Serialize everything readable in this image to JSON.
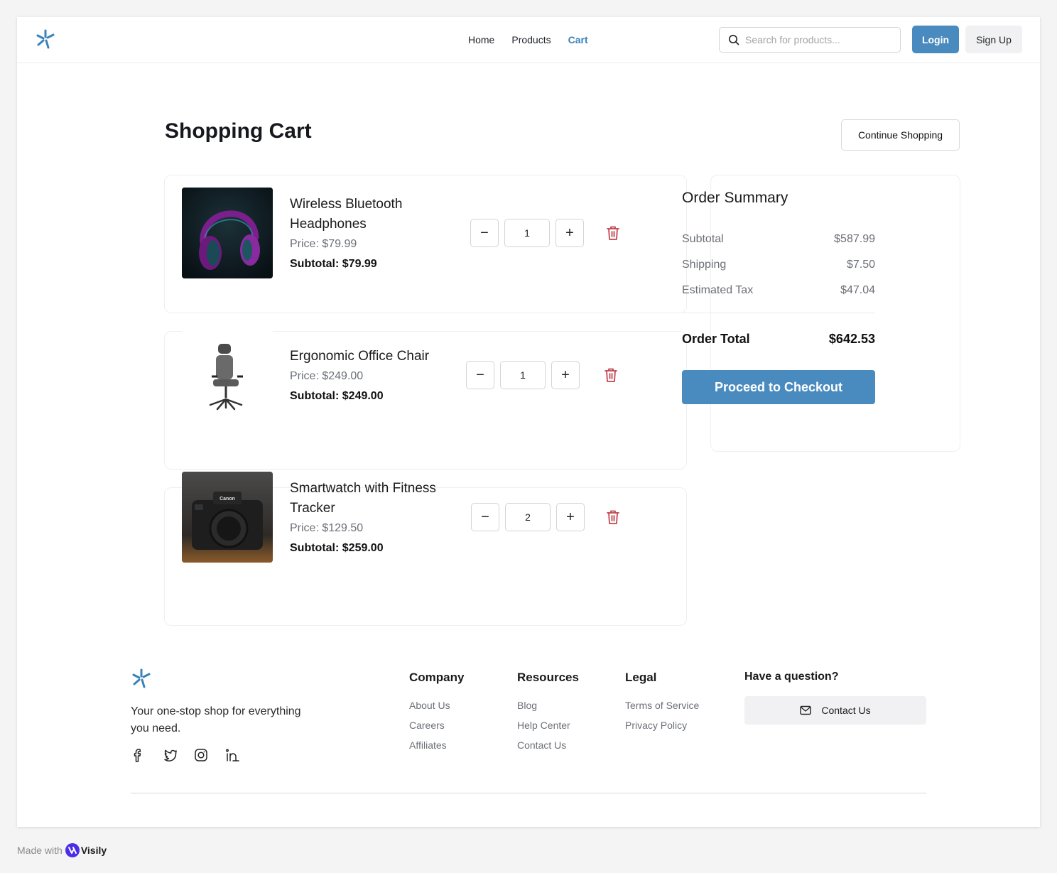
{
  "colors": {
    "accent": "#4a8bbf",
    "danger": "#c0444f",
    "text": "#1a1a1a",
    "muted": "#6b6f76"
  },
  "header": {
    "nav": [
      {
        "label": "Home",
        "active": false
      },
      {
        "label": "Products",
        "active": false
      },
      {
        "label": "Cart",
        "active": true
      }
    ],
    "search": {
      "placeholder": "Search for products...",
      "value": "",
      "icon": "search-icon"
    },
    "login_label": "Login",
    "signup_label": "Sign Up"
  },
  "page": {
    "title": "Shopping Cart",
    "continue_label": "Continue Shopping"
  },
  "cart": {
    "items": [
      {
        "name_line1": "Wireless Bluetooth",
        "name_line2": "Headphones",
        "price": "Price: $79.99",
        "subtotal": "Subtotal: $79.99",
        "quantity": "1",
        "image": "headphones-photo"
      },
      {
        "name_line1": "Ergonomic Office Chair",
        "name_line2": "",
        "price": "Price: $249.00",
        "subtotal": "Subtotal: $249.00",
        "quantity": "1",
        "image": "office-chair-photo"
      },
      {
        "name_line1": "Smartwatch with Fitness",
        "name_line2": "Tracker",
        "price": "Price: $129.50",
        "subtotal": "Subtotal: $259.00",
        "quantity": "2",
        "image": "camera-photo"
      }
    ],
    "decrement_glyph": "−",
    "increment_glyph": "+"
  },
  "summary": {
    "title": "Order Summary",
    "rows": [
      {
        "label": "Subtotal",
        "value": "$587.99"
      },
      {
        "label": "Shipping",
        "value": "$7.50"
      },
      {
        "label": "Estimated Tax",
        "value": "$47.04"
      }
    ],
    "total_label": "Order Total",
    "total_value": "$642.53",
    "checkout_label": "Proceed to Checkout"
  },
  "footer": {
    "tagline": "Your one-stop shop for everything you need.",
    "socials": [
      "facebook-icon",
      "twitter-icon",
      "instagram-icon",
      "linkedin-icon"
    ],
    "columns": [
      {
        "title": "Company",
        "links": [
          "About Us",
          "Careers",
          "Affiliates"
        ]
      },
      {
        "title": "Resources",
        "links": [
          "Blog",
          "Help Center",
          "Contact Us"
        ]
      },
      {
        "title": "Legal",
        "links": [
          "Terms of Service",
          "Privacy Policy"
        ]
      }
    ],
    "question": "Have a question?",
    "contact_label": "Contact Us"
  },
  "badge": {
    "made_with": "Made with",
    "brand": "Visily"
  }
}
